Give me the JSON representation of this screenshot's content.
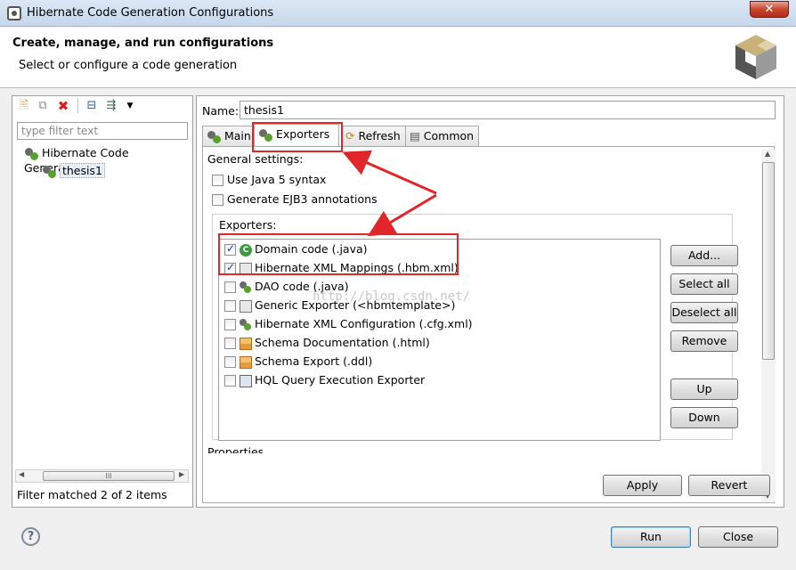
{
  "window": {
    "title": "Hibernate Code Generation Configurations",
    "close_label": "✕"
  },
  "header": {
    "title": "Create, manage, and run configurations",
    "subtitle": "Select or configure a code generation"
  },
  "left": {
    "filter_placeholder": "type filter text",
    "tree": [
      {
        "label": "Hibernate Code Generation"
      },
      {
        "label": "thesis1"
      }
    ],
    "status": "Filter matched 2 of 2 items",
    "scroll_grip": "III"
  },
  "main": {
    "name_label": "Name:",
    "name_value": "thesis1",
    "tabs": [
      {
        "label": "Main"
      },
      {
        "label": "Exporters"
      },
      {
        "label": "Refresh"
      },
      {
        "label": "Common"
      }
    ],
    "general_settings_label": "General settings:",
    "settings": [
      {
        "label": "Use Java 5 syntax",
        "checked": false
      },
      {
        "label": "Generate EJB3 annotations",
        "checked": false
      }
    ],
    "exporters_label": "Exporters:",
    "exporters": [
      {
        "label": "Domain code (.java)",
        "checked": true,
        "icon": "class-c-icon"
      },
      {
        "label": "Hibernate XML Mappings (.hbm.xml)",
        "checked": true,
        "icon": "xml-mapping-icon"
      },
      {
        "label": "DAO code (.java)",
        "checked": false,
        "icon": "hibernate-icon"
      },
      {
        "label": "Generic Exporter (<hbmtemplate>)",
        "checked": false,
        "icon": "xml-mapping-icon"
      },
      {
        "label": "Hibernate XML Configuration (.cfg.xml)",
        "checked": false,
        "icon": "hibernate-icon"
      },
      {
        "label": "Schema Documentation (.html)",
        "checked": false,
        "icon": "schema-icon"
      },
      {
        "label": "Schema Export (.ddl)",
        "checked": false,
        "icon": "schema-icon"
      },
      {
        "label": "HQL Query Execution Exporter",
        "checked": false,
        "icon": "hql-icon"
      }
    ],
    "side_buttons": {
      "add": "Add...",
      "select_all": "Select all",
      "deselect_all": "Deselect all",
      "remove": "Remove",
      "up": "Up",
      "down": "Down"
    },
    "truncated_label": "Properties",
    "apply": "Apply",
    "revert": "Revert"
  },
  "footer": {
    "help": "?",
    "run": "Run",
    "close": "Close"
  },
  "watermark": "http://blog.csdn.net/",
  "colors": {
    "annotation_red": "#e0262b",
    "accent_green": "#5aa02c"
  }
}
